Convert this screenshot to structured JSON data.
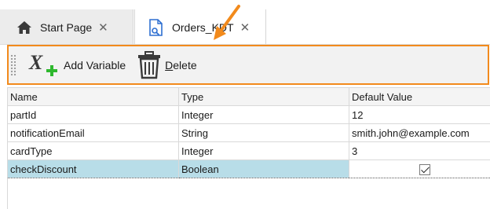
{
  "tabs": [
    {
      "label": "Start Page",
      "icon": "home-icon",
      "active": false
    },
    {
      "label": "Orders_KDT",
      "icon": "database-document-icon",
      "active": true
    }
  ],
  "colors": {
    "highlight": "#f28a1c",
    "selection": "#b8dde8",
    "tab_inactive": "#ececec",
    "toolbar": "#f2f2f2",
    "icon_green": "#2eb82e",
    "icon_blue": "#2e6fd1"
  },
  "toolbar": {
    "add_label": "Add Variable",
    "add_icon": "add-variable-icon",
    "delete_label": "Delete",
    "delete_icon": "trash-icon"
  },
  "grid": {
    "columns": [
      "Name",
      "Type",
      "Default Value"
    ],
    "rows": [
      {
        "name": "partId",
        "type": "Integer",
        "default": "12"
      },
      {
        "name": "notificationEmail",
        "type": "String",
        "default": "smith.john@example.com"
      },
      {
        "name": "cardType",
        "type": "Integer",
        "default": "3"
      },
      {
        "name": "checkDiscount",
        "type": "Boolean",
        "default": "",
        "checked": true,
        "selected": true
      }
    ]
  }
}
